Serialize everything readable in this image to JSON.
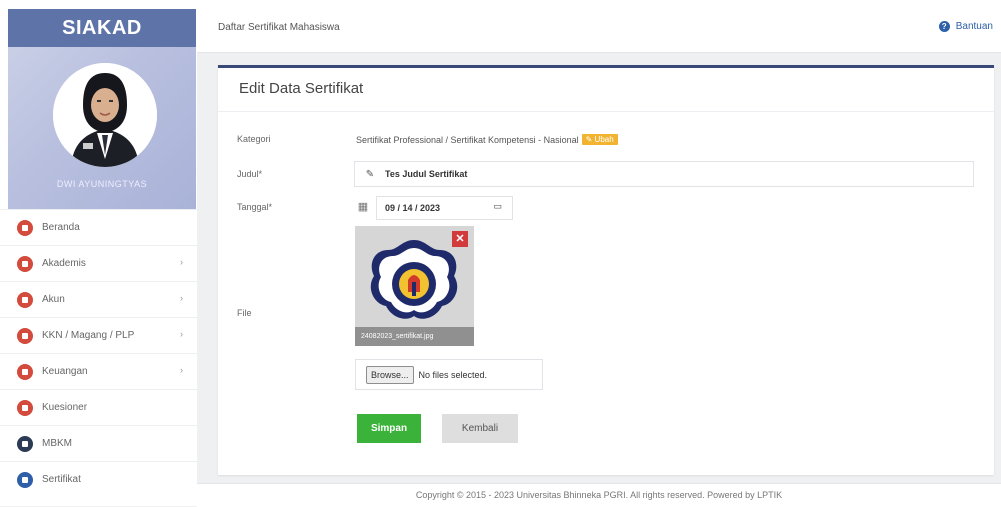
{
  "brand": "SIAKAD",
  "user": {
    "name": "DWI AYUNINGTYAS"
  },
  "menu": [
    {
      "label": "Beranda",
      "icon": "home-icon",
      "has_arrow": false
    },
    {
      "label": "Akademis",
      "icon": "book-icon",
      "has_arrow": true
    },
    {
      "label": "Akun",
      "icon": "gear-icon",
      "has_arrow": true
    },
    {
      "label": "KKN / Magang / PLP",
      "icon": "globe-icon",
      "has_arrow": true
    },
    {
      "label": "Keuangan",
      "icon": "money-icon",
      "has_arrow": true
    },
    {
      "label": "Kuesioner",
      "icon": "check-icon",
      "has_arrow": false
    },
    {
      "label": "MBKM",
      "icon": "mbkm-icon",
      "has_arrow": false
    },
    {
      "label": "Sertifikat",
      "icon": "certificate-icon",
      "has_arrow": false
    }
  ],
  "topbar": {
    "title": "Daftar Sertifikat Mahasiswa",
    "help_label": "Bantuan"
  },
  "form": {
    "heading": "Edit Data Sertifikat",
    "kategori_label": "Kategori",
    "kategori_value": "Sertifikat Professional / Sertifikat Kompetensi - Nasional",
    "ubah_label": "Ubah",
    "judul_label": "Judul*",
    "judul_value": "Tes Judul Sertifikat",
    "tanggal_label": "Tanggal*",
    "tanggal_value": "09 / 14 / 2023",
    "file_label": "File",
    "file_caption": "24082023_sertifikat.jpg",
    "browse_label": "Browse...",
    "no_file_text": "No files selected.",
    "save_label": "Simpan",
    "back_label": "Kembali"
  },
  "footer": {
    "text": "Copyright © 2015 - 2023 Universitas Bhinneka PGRI. All rights reserved. Powered by LPTIK"
  },
  "colors": {
    "brand": "#5e73a8",
    "save": "#3bb33b",
    "ubah": "#f2b430",
    "delete": "#d23b3b",
    "menu_icon": "#d24b3c"
  }
}
